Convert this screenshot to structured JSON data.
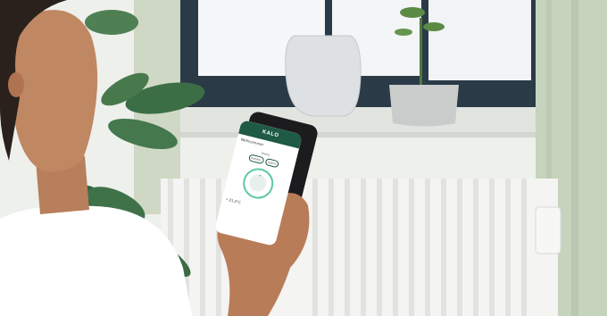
{
  "app": {
    "brand": "KALO",
    "room": "Wohnzimmer",
    "mode_label": "Status",
    "pills": [
      "Komfort",
      "Sparen"
    ],
    "temperature": "21,2°C"
  },
  "colors": {
    "app_header": "#1f5a45",
    "dial_ring": "#5cc7a5",
    "wall": "#eef0ec",
    "window_frame": "#2b3a47",
    "radiator": "#f4f4f2",
    "curtain": "#cfd8c4",
    "plant": "#3b6e45"
  },
  "icons": [
    "chevron-up-icon",
    "thermometer-icon"
  ]
}
